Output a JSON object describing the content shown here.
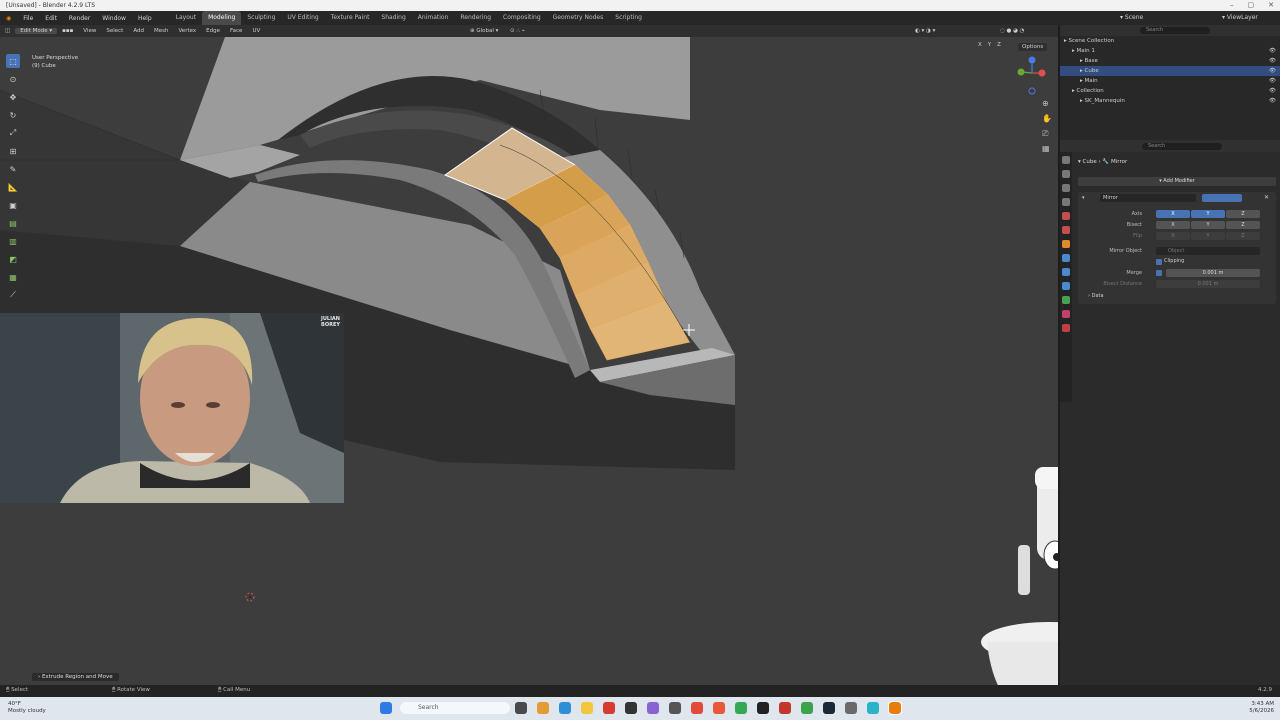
{
  "window": {
    "title": "[Unsaved] - Blender 4.2.9 LTS"
  },
  "menu": [
    "File",
    "Edit",
    "Render",
    "Window",
    "Help"
  ],
  "workspaces": [
    "Layout",
    "Modeling",
    "Sculpting",
    "UV Editing",
    "Texture Paint",
    "Shading",
    "Animation",
    "Rendering",
    "Compositing",
    "Geometry Nodes",
    "Scripting"
  ],
  "active_workspace": "Modeling",
  "scene": {
    "name": "Scene",
    "view_layer": "ViewLayer"
  },
  "viewport_header": {
    "mode": "Edit Mode",
    "menus": [
      "View",
      "Select",
      "Add",
      "Mesh",
      "Vertex",
      "Edge",
      "Face",
      "UV"
    ],
    "orientation": "Global",
    "options_label": "Options",
    "axes": [
      "X",
      "Y",
      "Z"
    ]
  },
  "viewport": {
    "overlay_line1": "User Perspective",
    "overlay_line2": "(9) Cube",
    "operator_panel": "Extrude Region and Move"
  },
  "webcam_label": "JULIAN\nBOREY",
  "outliner": {
    "search_placeholder": "Search",
    "title": "Scene Collection",
    "rows": [
      {
        "label": "Main 1",
        "indent": 1,
        "selected": false
      },
      {
        "label": "Base",
        "indent": 2,
        "selected": false
      },
      {
        "label": "Cube",
        "indent": 2,
        "selected": true
      },
      {
        "label": "Main",
        "indent": 2,
        "selected": false
      },
      {
        "label": "Collection",
        "indent": 1,
        "selected": false
      },
      {
        "label": "SK_Mannequin",
        "indent": 2,
        "selected": false
      }
    ]
  },
  "properties": {
    "search_placeholder": "Search",
    "breadcrumb_object": "Cube",
    "breadcrumb_modifier": "Mirror",
    "add_modifier": "Add Modifier",
    "modifier_name": "Mirror",
    "labels": {
      "axis": "Axis",
      "bisect": "Bisect",
      "flip": "Flip",
      "mirror_object": "Mirror Object",
      "clipping": "Clipping",
      "merge": "Merge",
      "bisect_distance": "Bisect Distance",
      "data": "Data"
    },
    "axis_buttons": [
      "X",
      "Y",
      "Z"
    ],
    "mirror_object_placeholder": "Object",
    "merge_value": "0.001 m",
    "bisect_distance_value": "0.001 m"
  },
  "statusbar": {
    "items": [
      "Select",
      "Rotate View",
      "Call Menu"
    ],
    "version": "4.2.9"
  },
  "taskbar": {
    "weather_temp": "40°F",
    "weather_desc": "Mostly cloudy",
    "search_placeholder": "Search",
    "time": "3:43 AM",
    "date": "5/6/2026"
  },
  "colors": {
    "accent": "#4772b3",
    "selected_face": "#d9a45a",
    "viewport_bg": "#3d3d3d"
  }
}
